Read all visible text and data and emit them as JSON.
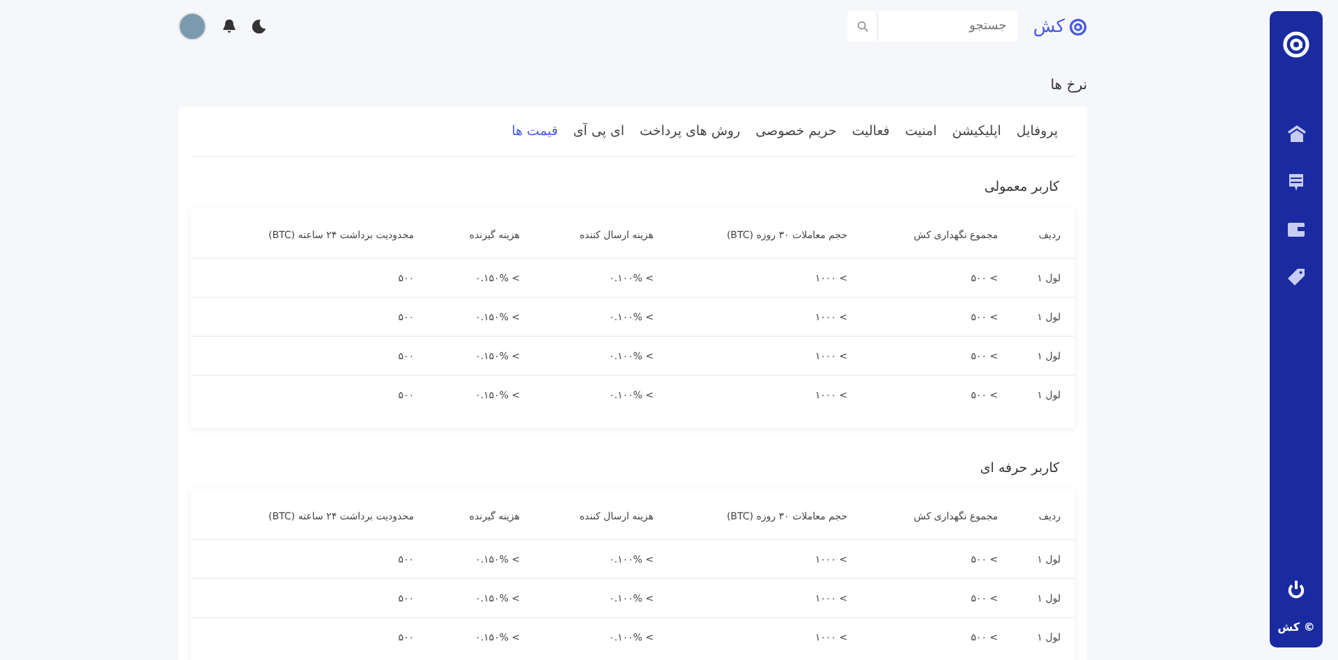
{
  "sidebar": {
    "footer": "© کش"
  },
  "header": {
    "logo": "کش",
    "search": {
      "placeholder": "جستجو"
    }
  },
  "page_title": "نرخ ها",
  "tabs": [
    {
      "label": "پروفایل",
      "selected": false
    },
    {
      "label": "اپلیکیشن",
      "selected": false
    },
    {
      "label": "امنیت",
      "selected": false
    },
    {
      "label": "فعالیت",
      "selected": false
    },
    {
      "label": "حریم خصوصی",
      "selected": false
    },
    {
      "label": "روش های پرداخت",
      "selected": false
    },
    {
      "label": "ای پی آی",
      "selected": false
    },
    {
      "label": "قیمت ها",
      "selected": true
    }
  ],
  "sections": [
    {
      "title": "کاربر معمولی",
      "columns": [
        "ردیف",
        "مجموع نگهداری کش",
        "حجم معاملات ۳۰ روزه (BTC)",
        "هزینه ارسال کننده",
        "هزینه گیرنده",
        "محدودیت برداشت ۲۴ ساعته (BTC)"
      ],
      "rows": [
        [
          "لول ۱",
          "۵۰۰ <",
          "۱۰۰۰ <",
          "۰.۱۰۰% <",
          "۰.۱۵۰% <",
          "۵۰۰"
        ],
        [
          "لول ۱",
          "۵۰۰ <",
          "۱۰۰۰ <",
          "۰.۱۰۰% <",
          "۰.۱۵۰% <",
          "۵۰۰"
        ],
        [
          "لول ۱",
          "۵۰۰ <",
          "۱۰۰۰ <",
          "۰.۱۰۰% <",
          "۰.۱۵۰% <",
          "۵۰۰"
        ],
        [
          "لول ۱",
          "۵۰۰ <",
          "۱۰۰۰ <",
          "۰.۱۰۰% <",
          "۰.۱۵۰% <",
          "۵۰۰"
        ]
      ]
    },
    {
      "title": "کاربر حرفه ای",
      "columns": [
        "ردیف",
        "مجموع نگهداری کش",
        "حجم معاملات ۳۰ روزه (BTC)",
        "هزینه ارسال کننده",
        "هزینه گیرنده",
        "محدودیت برداشت ۲۴ ساعته (BTC)"
      ],
      "rows": [
        [
          "لول ۱",
          "۵۰۰ <",
          "۱۰۰۰ <",
          "۰.۱۰۰% <",
          "۰.۱۵۰% <",
          "۵۰۰"
        ],
        [
          "لول ۱",
          "۵۰۰ <",
          "۱۰۰۰ <",
          "۰.۱۰۰% <",
          "۰.۱۵۰% <",
          "۵۰۰"
        ],
        [
          "لول ۱",
          "۵۰۰ <",
          "۱۰۰۰ <",
          "۰.۱۰۰% <",
          "۰.۱۵۰% <",
          "۵۰۰"
        ]
      ]
    }
  ]
}
